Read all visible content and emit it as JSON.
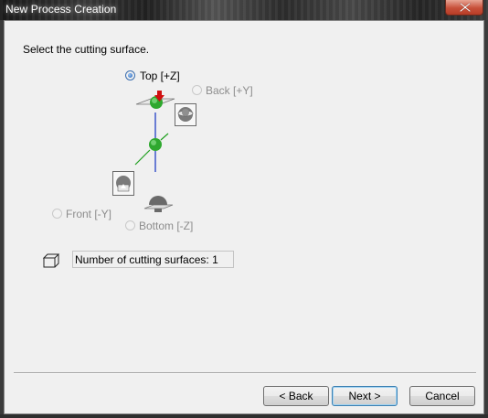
{
  "window": {
    "title": "New Process Creation"
  },
  "prompt": "Select the cutting surface.",
  "surfaces": {
    "top": {
      "label": "Top [+Z]",
      "selected": true,
      "enabled": true
    },
    "back": {
      "label": "Back [+Y]",
      "selected": false,
      "enabled": false
    },
    "front": {
      "label": "Front [-Y]",
      "selected": false,
      "enabled": false
    },
    "bottom": {
      "label": "Bottom [-Z]",
      "selected": false,
      "enabled": false
    }
  },
  "count_field": {
    "text": "Number of cutting surfaces: 1"
  },
  "buttons": {
    "back": "< Back",
    "next": "Next >",
    "cancel": "Cancel"
  },
  "colors": {
    "accent": "#2ea82e",
    "arrow": "#d01010",
    "axis_blue": "#1030c0",
    "axis_green": "#20a020"
  },
  "icons": [
    "close-icon",
    "sphere-icon",
    "down-arrow-icon",
    "back-view-icon",
    "front-view-icon",
    "bottom-plane-icon",
    "box-icon"
  ]
}
